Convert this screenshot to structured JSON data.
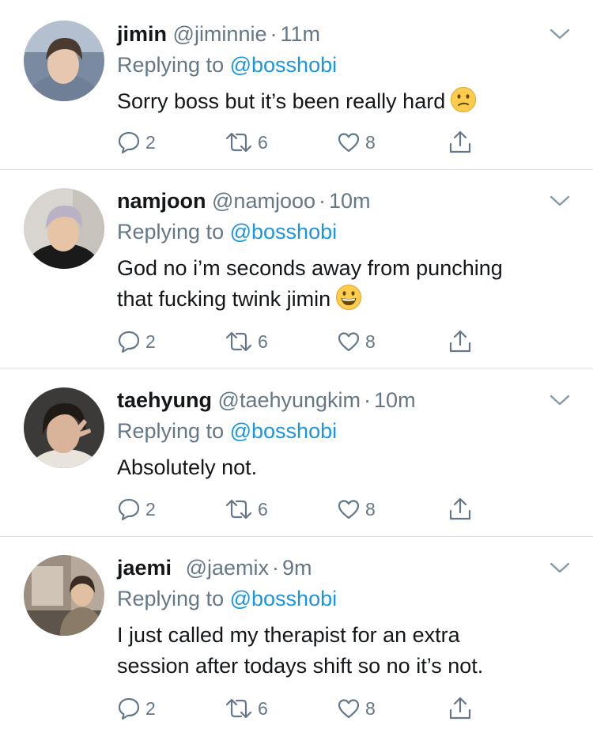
{
  "tweets": [
    {
      "name": "jimin",
      "handle": "@jiminnie",
      "sep": "·",
      "time": "11m",
      "replying": "Replying to",
      "mention": "@bosshobi",
      "lines": [
        "Sorry boss but it’s been really hard"
      ],
      "emoji": "confused-face",
      "replies": "2",
      "retweets": "6",
      "likes": "8",
      "avatar": {
        "bg": "#7a8aa0",
        "hair": "#4a3a30",
        "skin": "#e8c7b0",
        "cloth": "#6e7f96"
      }
    },
    {
      "name": "namjoon",
      "handle": "@namjooo",
      "sep": "·",
      "time": "10m",
      "replying": "Replying to",
      "mention": "@bosshobi",
      "lines": [
        "God no i’m seconds away from punching",
        "that fucking twink jimin"
      ],
      "emoji": "grinning-face",
      "replies": "2",
      "retweets": "6",
      "likes": "8",
      "avatar": {
        "bg": "#d8d4cf",
        "hair": "#b9b2c4",
        "skin": "#e6c4a5",
        "cloth": "#1a1a1a"
      }
    },
    {
      "name": "taehyung",
      "handle": "@taehyungkim",
      "sep": "·",
      "time": "10m",
      "replying": "Replying to",
      "mention": "@bosshobi",
      "lines": [
        "Absolutely not."
      ],
      "emoji": "",
      "replies": "2",
      "retweets": "6",
      "likes": "8",
      "avatar": {
        "bg": "#3b3a38",
        "hair": "#1f1a16",
        "skin": "#d9b49a",
        "cloth": "#e8e4dc"
      }
    },
    {
      "name": "jaemi",
      "handle": "@jaemix",
      "sep": "·",
      "time": "9m",
      "replying": "Replying to",
      "mention": "@bosshobi",
      "lines": [
        "I just called my therapist for an extra",
        "session after todays shift so no it’s not."
      ],
      "emoji": "",
      "replies": "2",
      "retweets": "6",
      "likes": "8",
      "avatar": {
        "bg": "#b6a89a",
        "hair": "#3a2c22",
        "skin": "#e0bfa2",
        "cloth": "#8a7a68"
      }
    }
  ],
  "colors": {
    "text": "#14171a",
    "meta": "#657786",
    "link": "#1b95e0",
    "divider": "#dfe3e6"
  }
}
